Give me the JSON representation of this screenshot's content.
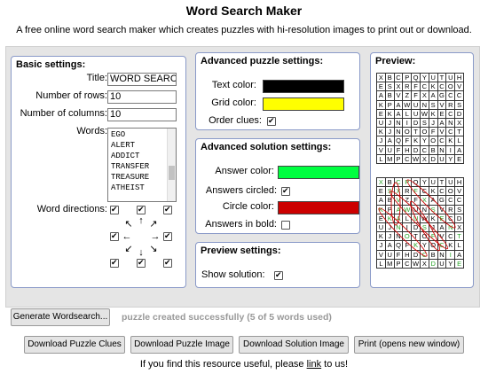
{
  "header": {
    "title": "Word Search Maker",
    "subtitle": "A free online word search maker which creates puzzles with hi-resolution images to print out or download."
  },
  "basic": {
    "heading": "Basic settings:",
    "title_label": "Title:",
    "title_value": "WORD SEARCH",
    "rows_label": "Number of rows:",
    "rows_value": "10",
    "cols_label": "Number of columns:",
    "cols_value": "10",
    "words_label": "Words:",
    "words": [
      "EGO",
      "ALERT",
      "ADDICT",
      "TRANSFER",
      "TREASURE",
      "ATHEIST"
    ],
    "directions_label": "Word directions:",
    "arrows": [
      "↖",
      "↑",
      "↗",
      "←",
      "→",
      "↙",
      "↓",
      "↘"
    ]
  },
  "advanced_puzzle": {
    "heading": "Advanced puzzle settings:",
    "text_color_label": "Text color:",
    "text_color": "#000000",
    "grid_color_label": "Grid color:",
    "grid_color": "#ffff00",
    "order_clues_label": "Order clues:"
  },
  "advanced_solution": {
    "heading": "Advanced solution settings:",
    "answer_color_label": "Answer color:",
    "answer_color": "#00ff40",
    "circled_label": "Answers circled:",
    "circle_color_label": "Circle color:",
    "circle_color": "#cc0000",
    "bold_label": "Answers in bold:"
  },
  "preview_settings": {
    "heading": "Preview settings:",
    "show_solution_label": "Show solution:"
  },
  "preview": {
    "heading": "Preview:",
    "grid": [
      [
        "X",
        "B",
        "C",
        "P",
        "Q",
        "Y",
        "U",
        "T",
        "U",
        "H"
      ],
      [
        "E",
        "S",
        "X",
        "R",
        "F",
        "C",
        "K",
        "C",
        "O",
        "V"
      ],
      [
        "A",
        "B",
        "V",
        "Z",
        "F",
        "X",
        "A",
        "G",
        "C",
        "C"
      ],
      [
        "K",
        "P",
        "A",
        "W",
        "U",
        "N",
        "S",
        "V",
        "R",
        "S"
      ],
      [
        "E",
        "K",
        "A",
        "L",
        "U",
        "W",
        "K",
        "E",
        "C",
        "D"
      ],
      [
        "U",
        "J",
        "N",
        "I",
        "D",
        "S",
        "J",
        "A",
        "N",
        "X"
      ],
      [
        "K",
        "J",
        "N",
        "O",
        "T",
        "O",
        "F",
        "V",
        "C",
        "T"
      ],
      [
        "J",
        "A",
        "Q",
        "F",
        "K",
        "Y",
        "O",
        "C",
        "K",
        "L"
      ],
      [
        "V",
        "U",
        "F",
        "H",
        "D",
        "C",
        "B",
        "N",
        "I",
        "A"
      ],
      [
        "L",
        "M",
        "P",
        "C",
        "W",
        "X",
        "D",
        "U",
        "Y",
        "E"
      ]
    ],
    "solution_grid": [
      [
        "X",
        "B",
        "C",
        "P",
        "Q",
        "Y",
        "U",
        "T",
        "U",
        "H"
      ],
      [
        "E",
        "S",
        "X",
        "R",
        "F",
        "C",
        "K",
        "C",
        "O",
        "V"
      ],
      [
        "A",
        "B",
        "V",
        "Z",
        "F",
        "X",
        "A",
        "G",
        "C",
        "C"
      ],
      [
        "K",
        "P",
        "A",
        "W",
        "U",
        "N",
        "S",
        "V",
        "R",
        "S"
      ],
      [
        "E",
        "K",
        "A",
        "L",
        "U",
        "W",
        "K",
        "E",
        "C",
        "D"
      ],
      [
        "U",
        "J",
        "N",
        "I",
        "D",
        "S",
        "J",
        "A",
        "N",
        "X"
      ],
      [
        "K",
        "J",
        "N",
        "O",
        "T",
        "O",
        "F",
        "V",
        "C",
        "T"
      ],
      [
        "J",
        "A",
        "Q",
        "F",
        "K",
        "Y",
        "O",
        "C",
        "K",
        "L"
      ],
      [
        "V",
        "U",
        "F",
        "H",
        "D",
        "C",
        "B",
        "N",
        "I",
        "A"
      ],
      [
        "L",
        "M",
        "P",
        "C",
        "W",
        "X",
        "D",
        "U",
        "Y",
        "E"
      ]
    ]
  },
  "actions": {
    "generate_label": "Generate Wordsearch...",
    "status_text": "puzzle created successfully (5 of 5 words used)",
    "download_clues": "Download Puzzle Clues",
    "download_image": "Download Puzzle Image",
    "download_solution": "Download Solution Image",
    "print": "Print (opens new window)"
  },
  "footer": {
    "before": "If you find this resource useful, please ",
    "link": "link",
    "after": " to us!"
  }
}
